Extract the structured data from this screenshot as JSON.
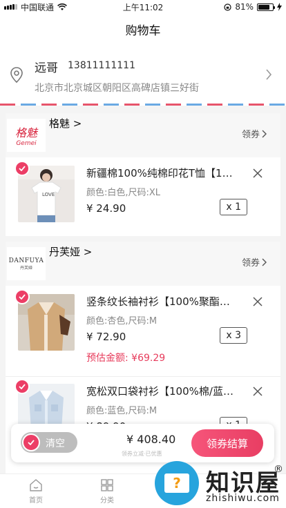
{
  "status_bar": {
    "carrier": "中国联通",
    "time": "上午11:02",
    "battery": "81%"
  },
  "nav": {
    "title": "购物车"
  },
  "address": {
    "name": "远哥",
    "phone": "13811111111",
    "detail": "北京市北京城区朝阳区高碑店镇三好街"
  },
  "shops": [
    {
      "name": "格魅 >",
      "logo_text": "格魅",
      "logo_sub": "Gemei",
      "coupon_label": "领券",
      "items": [
        {
          "title": "新疆棉100%纯棉印花T恤【10…",
          "spec": "颜色:白色,尺码:XL",
          "price": "¥ 24.90",
          "qty": "x 1"
        }
      ]
    },
    {
      "name": "丹芙娅 >",
      "logo_text": "DANFUYA",
      "logo_sub": "丹芙娅",
      "coupon_label": "领券",
      "items": [
        {
          "title": "竖条纹长袖衬衫【100%聚酯纤…",
          "spec": "颜色:杏色,尺码:M",
          "price": "¥ 72.90",
          "qty": "x 3",
          "estimate": "预估金额: ¥69.29"
        },
        {
          "title": "宽松双口袋衬衫【100%棉/蓝…",
          "spec": "颜色:蓝色,尺码:M",
          "price": "¥ 89.90",
          "qty": "x 1"
        }
      ]
    }
  ],
  "checkout": {
    "clear_label": "清空",
    "total": "¥ 408.40",
    "note": "领券立减·已优惠",
    "pay_label": "领券结算"
  },
  "tabbar": [
    {
      "label": "首页"
    },
    {
      "label": "分类"
    }
  ],
  "watermark": {
    "big": "知识屋",
    "small": "zhishiwu.com",
    "reg": "®"
  },
  "colors": {
    "accent": "#ec3e66",
    "stripe_red": "#e7546b",
    "stripe_blue": "#6aa9e3",
    "watermark_blue": "#27a4dd"
  }
}
